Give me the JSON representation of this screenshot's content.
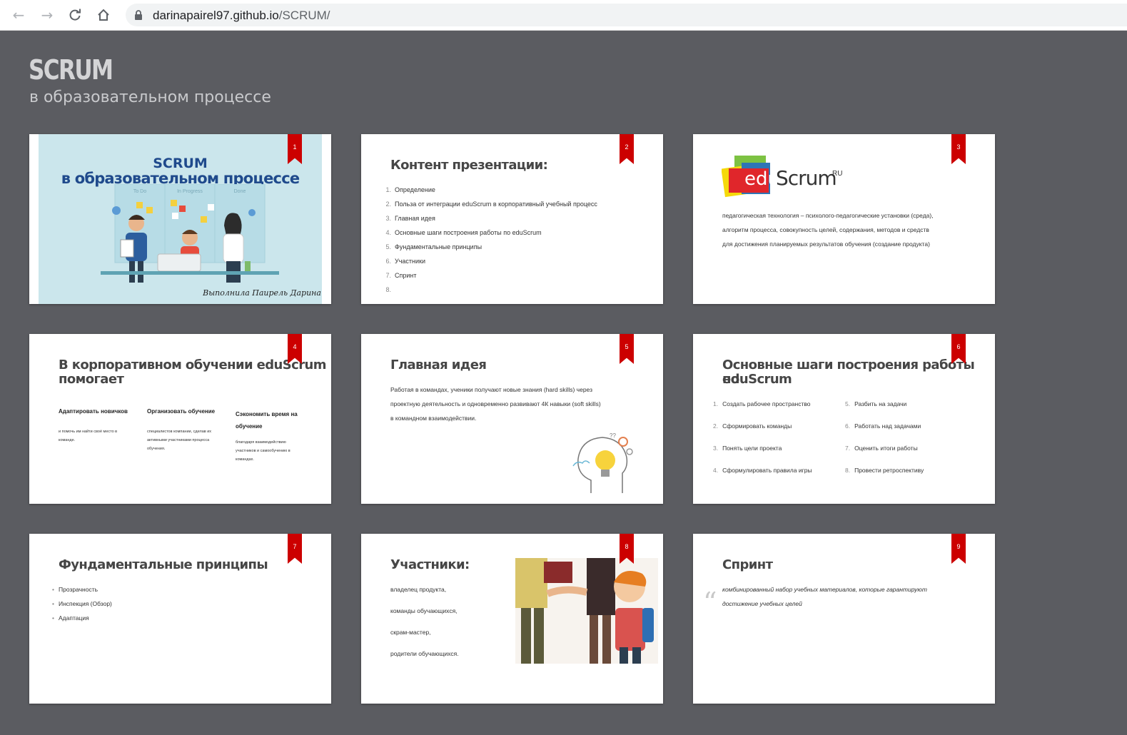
{
  "browser": {
    "url_host": "darinapairel97.github.io",
    "url_path": "/SCRUM/"
  },
  "deck": {
    "title": "SCRUM",
    "subtitle": "в образовательном процессе"
  },
  "slides": [
    {
      "number": "1",
      "title_line1": "SCRUM",
      "title_line2": "в образовательном процессе",
      "board_headers": [
        "To Do",
        "In Progress",
        "Done"
      ],
      "author": "Выполнила Паирель Дарина"
    },
    {
      "number": "2",
      "title": "Контент презентации:",
      "items": [
        {
          "n": "1.",
          "text": "Определение"
        },
        {
          "n": "2.",
          "text": "Польза от интеграции eduScrum в корпоративный учебный процесс"
        },
        {
          "n": "3.",
          "text": "Главная идея"
        },
        {
          "n": "4.",
          "text": "Основные шаги построения работы по eduScrum"
        },
        {
          "n": "5.",
          "text": "Фундаментальные принципы"
        },
        {
          "n": "6.",
          "text": "Участники"
        },
        {
          "n": "7.",
          "text": "Спринт"
        },
        {
          "n": "8.",
          "text": ""
        }
      ]
    },
    {
      "number": "3",
      "logo_edu": "edu",
      "logo_scrum": "Scrum",
      "logo_ru": "RU",
      "lines": [
        "педагогическая технология – психолого-педагогические установки (среда),",
        "алгоритм процесса, совокупность целей, содержания, методов и средств",
        "для достижения планируемых результатов обучения (создание продукта)"
      ]
    },
    {
      "number": "4",
      "title_line1": "В корпоративном обучении eduScrum",
      "title_line2": "помогает",
      "columns": [
        {
          "heading": "Адаптировать новичков",
          "text": "и помочь им найти своё место в команде."
        },
        {
          "heading": "Организовать обучение",
          "text": "специалистов компании, сделав их активными участниками процесса обучения."
        },
        {
          "heading": "Сэкономить время на обучение",
          "text": "благодаря взаимодействию участников и самообучению в командах."
        }
      ]
    },
    {
      "number": "5",
      "title": "Главная идея",
      "lines": [
        "Работая в командах, ученики получают новые знания (hard skills) через",
        "проектную деятельность и одновременно развивают 4К навыки (soft skills)",
        "в командном взаимодействии."
      ]
    },
    {
      "number": "6",
      "title_line1": "Основные шаги построения работы по",
      "title_line2": "eduScrum",
      "left": [
        {
          "n": "1.",
          "text": "Создать рабочее пространство"
        },
        {
          "n": "2.",
          "text": "Сформировать команды"
        },
        {
          "n": "3.",
          "text": "Понять цели проекта"
        },
        {
          "n": "4.",
          "text": "Сформулировать правила игры"
        }
      ],
      "right": [
        {
          "n": "5.",
          "text": "Разбить на задачи"
        },
        {
          "n": "6.",
          "text": "Работать над задачами"
        },
        {
          "n": "7.",
          "text": "Оценить итоги работы"
        },
        {
          "n": "8.",
          "text": "Провести ретроспективу"
        }
      ]
    },
    {
      "number": "7",
      "title": "Фундаментальные принципы",
      "items": [
        "Прозрачность",
        "Инспекция (Обзор)",
        "Адаптация"
      ]
    },
    {
      "number": "8",
      "title": "Участники:",
      "items": [
        "владелец продукта,",
        "команды обучающихся,",
        "скрам-мастер,",
        "родители обучающихся."
      ]
    },
    {
      "number": "9",
      "title": "Спринт",
      "quote_mark": "“",
      "quote_line1": "комбинированный набор учебных материалов, которые гарантируют",
      "quote_line2": "достижение учебных целей"
    }
  ],
  "colors": {
    "page_bg": "#5b5c61",
    "ribbon": "#cc0000",
    "slide_title": "#464646"
  }
}
